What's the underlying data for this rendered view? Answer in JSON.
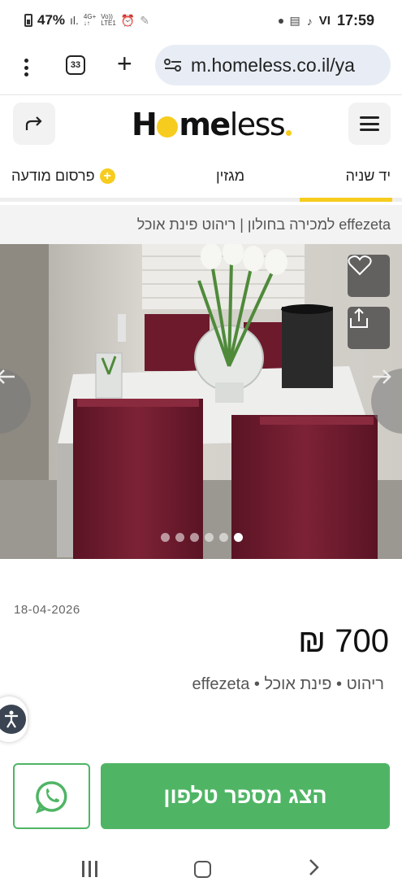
{
  "status_bar": {
    "battery_percent": "47%",
    "net_top": "4G+",
    "net_bottom": "LTE1",
    "volte_top": "Vo))",
    "carrier": "VI",
    "time": "17:59"
  },
  "browser": {
    "tab_count": "33",
    "url": "m.homeless.co.il/ya"
  },
  "site_header": {
    "logo": {
      "part1": "H",
      "part2": "me",
      "part3": "less"
    }
  },
  "nav": {
    "tabs": [
      {
        "label": "יד שניה",
        "active": true
      },
      {
        "label": "מגזין",
        "active": false
      },
      {
        "label": "פרסום מודעה",
        "active": false
      }
    ]
  },
  "breadcrumb": "effezeta למכירה בחולון | ריהוט פינת אוכל",
  "gallery": {
    "total_images": 6,
    "current_index": 6
  },
  "listing": {
    "date": "18-04-2026",
    "price": "700 ₪",
    "tags": "ריהוט • פינת אוכל • effezeta"
  },
  "actions": {
    "show_phone_label": "הצג מספר טלפון"
  },
  "colors": {
    "brand_yellow": "#f6cc1e",
    "cta_green": "#4fb565"
  }
}
